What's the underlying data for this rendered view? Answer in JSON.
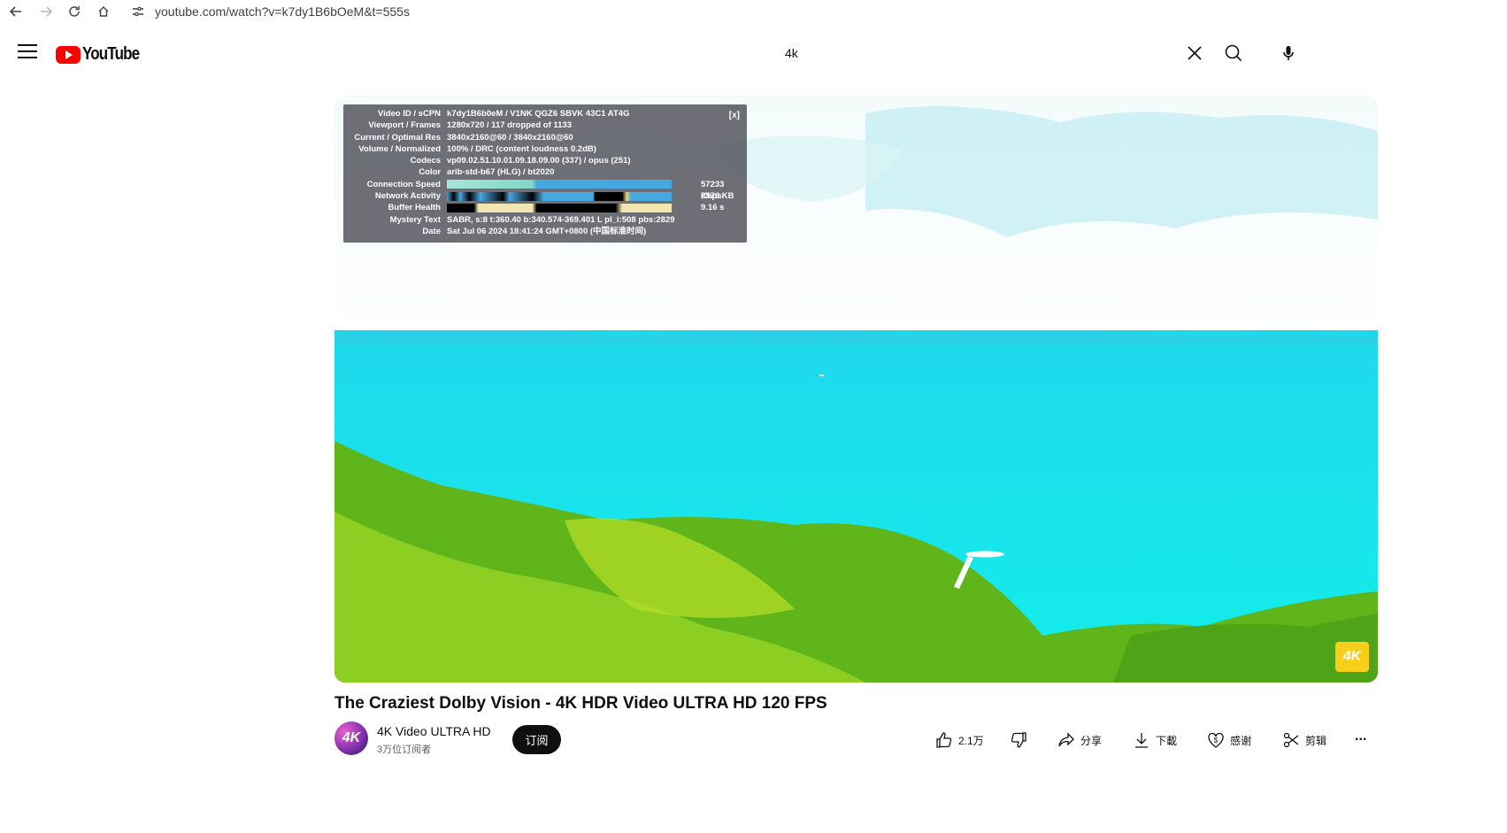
{
  "browser": {
    "url": "youtube.com/watch?v=k7dy1B6bOeM&t=555s"
  },
  "header": {
    "logo_text": "YouTube",
    "search_value": "4k"
  },
  "stats": {
    "close": "[x]",
    "rows": [
      {
        "key": "Video ID / sCPN",
        "value": "k7dy1B6b0eM  /  V1NK  QGZ6  SBVK  43C1  AT4G"
      },
      {
        "key": "Viewport / Frames",
        "value": "1280x720 / 117 dropped of 1133"
      },
      {
        "key": "Current / Optimal Res",
        "value": "3840x2160@60 / 3840x2160@60"
      },
      {
        "key": "Volume / Normalized",
        "value": "100% / DRC (content loudness 0.2dB)"
      },
      {
        "key": "Codecs",
        "value": "vp09.02.51.10.01.09.18.09.00 (337) / opus (251)"
      },
      {
        "key": "Color",
        "value": "arib-std-b67 (HLG) / bt2020"
      },
      {
        "key": "Connection Speed",
        "value": "57233 Kbps"
      },
      {
        "key": "Network Activity",
        "value": "2576 KB"
      },
      {
        "key": "Buffer Health",
        "value": "9.16 s"
      },
      {
        "key": "Mystery Text",
        "value": "SABR, s:8 t:360.40 b:340.574-369.401 L pl_i:508 pbs:2829"
      },
      {
        "key": "Date",
        "value": "Sat Jul 06 2024 18:41:24 GMT+0800 (中国标准时间)"
      }
    ]
  },
  "player": {
    "badge": "4K"
  },
  "video": {
    "title": "The Craziest Dolby Vision - 4K HDR Video ULTRA HD 120 FPS",
    "channel_name": "4K Video ULTRA HD",
    "subscribers": "3万位订阅者",
    "avatar_text": "4K",
    "subscribe_label": "订阅"
  },
  "actions": {
    "like_count": "2.1万",
    "share": "分享",
    "download": "下載",
    "thanks": "感谢",
    "clip": "剪辑",
    "more": "..."
  },
  "colors": {
    "brand_red": "#ff0000",
    "sea": "#16e8ea",
    "forest": "#6fbf1c",
    "badge": "#f7ce1a"
  }
}
